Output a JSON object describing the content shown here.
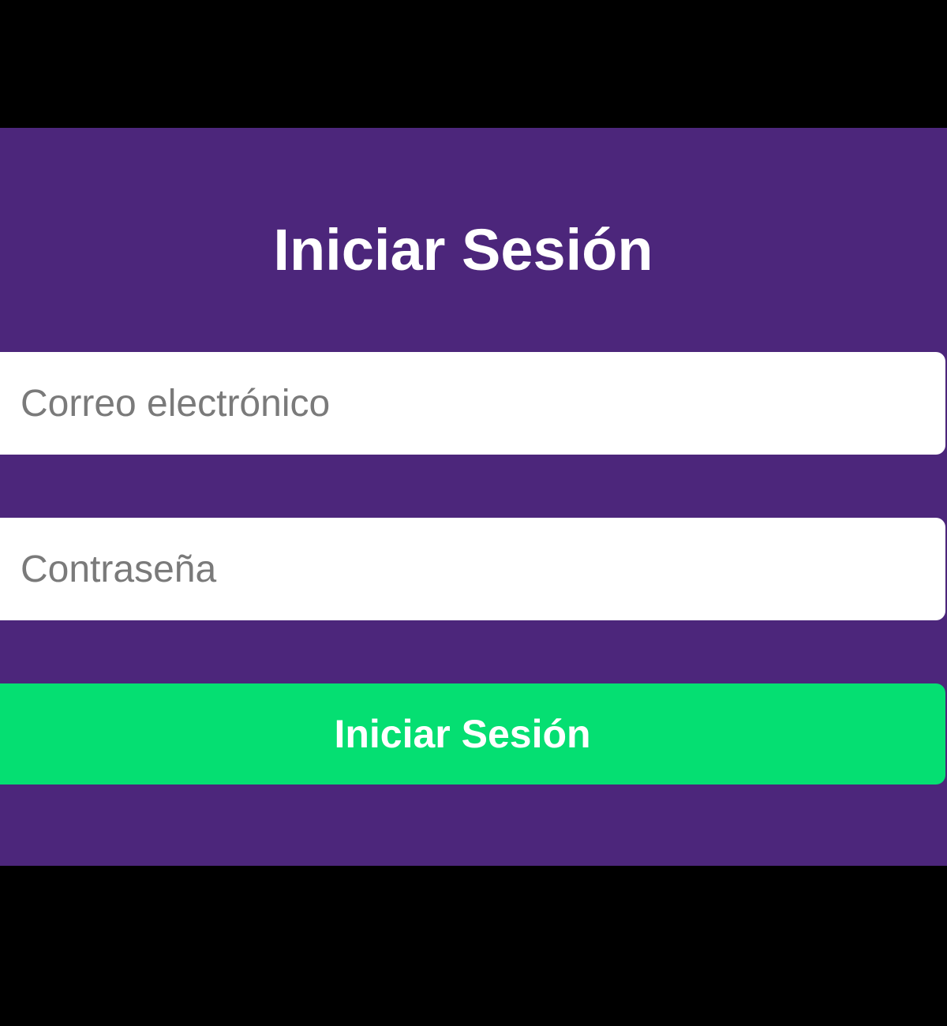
{
  "login": {
    "title": "Iniciar Sesión",
    "email_placeholder": "Correo electrónico",
    "email_value": "",
    "password_placeholder": "Contraseña",
    "password_value": "",
    "submit_label": "Iniciar Sesión"
  },
  "colors": {
    "page_background": "#000000",
    "panel_background": "#4c267b",
    "button_background": "#05df72",
    "input_background": "#ffffff",
    "placeholder_text": "#7a7a7a"
  }
}
